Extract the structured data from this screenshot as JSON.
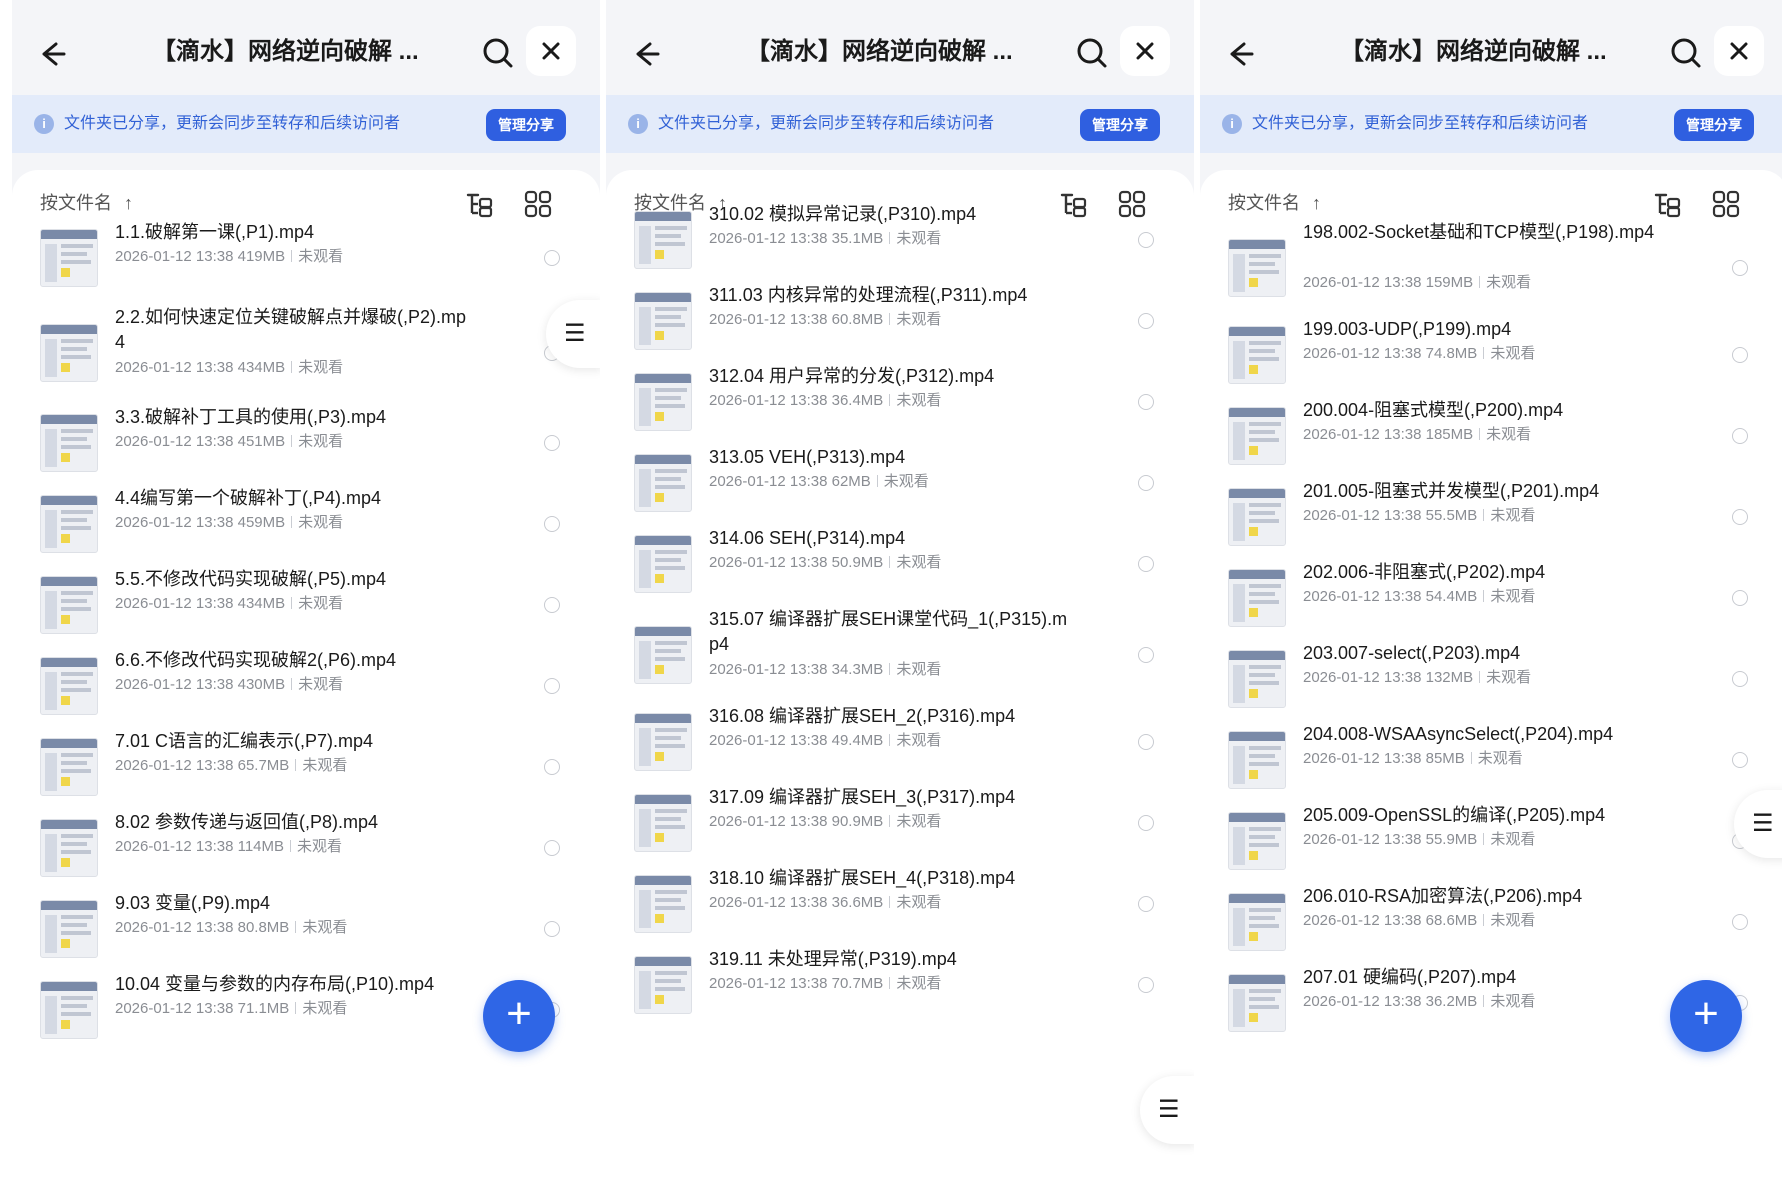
{
  "panels": [
    {
      "title": "【滴水】网络逆向破解 ...",
      "banner_text": "文件夹已分享，更新会同步至转存和后续访问者",
      "manage_label": "管理分享",
      "sort_label": "按文件名",
      "sort_arrow": "↑",
      "files": [
        {
          "name": "1.1.破解第一课(,P1).mp4",
          "date": "2026-01-12 13:38",
          "size": "419MB",
          "status": "未观看"
        },
        {
          "name": "2.2.如何快速定位关键破解点并爆破(,P2).mp4",
          "date": "2026-01-12 13:38",
          "size": "434MB",
          "status": "未观看"
        },
        {
          "name": "3.3.破解补丁工具的使用(,P3).mp4",
          "date": "2026-01-12 13:38",
          "size": "451MB",
          "status": "未观看"
        },
        {
          "name": "4.4编写第一个破解补丁(,P4).mp4",
          "date": "2026-01-12 13:38",
          "size": "459MB",
          "status": "未观看"
        },
        {
          "name": "5.5.不修改代码实现破解(,P5).mp4",
          "date": "2026-01-12 13:38",
          "size": "434MB",
          "status": "未观看"
        },
        {
          "name": "6.6.不修改代码实现破解2(,P6).mp4",
          "date": "2026-01-12 13:38",
          "size": "430MB",
          "status": "未观看"
        },
        {
          "name": "7.01 C语言的汇编表示(,P7).mp4",
          "date": "2026-01-12 13:38",
          "size": "65.7MB",
          "status": "未观看"
        },
        {
          "name": "8.02 参数传递与返回值(,P8).mp4",
          "date": "2026-01-12 13:38",
          "size": "114MB",
          "status": "未观看"
        },
        {
          "name": "9.03 变量(,P9).mp4",
          "date": "2026-01-12 13:38",
          "size": "80.8MB",
          "status": "未观看"
        },
        {
          "name": "10.04 变量与参数的内存布局(,P10).mp4",
          "date": "2026-01-12 13:38",
          "size": "71.1MB",
          "status": "未观看"
        }
      ]
    },
    {
      "title": "【滴水】网络逆向破解 ...",
      "banner_text": "文件夹已分享，更新会同步至转存和后续访问者",
      "manage_label": "管理分享",
      "sort_label": "按文件名",
      "sort_arrow": "↑",
      "files": [
        {
          "name": "310.02 模拟异常记录(,P310).mp4",
          "date": "2026-01-12 13:38",
          "size": "35.1MB",
          "status": "未观看"
        },
        {
          "name": "311.03 内核异常的处理流程(,P311).mp4",
          "date": "2026-01-12 13:38",
          "size": "60.8MB",
          "status": "未观看"
        },
        {
          "name": "312.04 用户异常的分发(,P312).mp4",
          "date": "2026-01-12 13:38",
          "size": "36.4MB",
          "status": "未观看"
        },
        {
          "name": "313.05 VEH(,P313).mp4",
          "date": "2026-01-12 13:38",
          "size": "62MB",
          "status": "未观看"
        },
        {
          "name": "314.06 SEH(,P314).mp4",
          "date": "2026-01-12 13:38",
          "size": "50.9MB",
          "status": "未观看"
        },
        {
          "name": "315.07 编译器扩展SEH课堂代码_1(,P315).mp4",
          "date": "2026-01-12 13:38",
          "size": "34.3MB",
          "status": "未观看"
        },
        {
          "name": "316.08 编译器扩展SEH_2(,P316).mp4",
          "date": "2026-01-12 13:38",
          "size": "49.4MB",
          "status": "未观看"
        },
        {
          "name": "317.09 编译器扩展SEH_3(,P317).mp4",
          "date": "2026-01-12 13:38",
          "size": "90.9MB",
          "status": "未观看"
        },
        {
          "name": "318.10 编译器扩展SEH_4(,P318).mp4",
          "date": "2026-01-12 13:38",
          "size": "36.6MB",
          "status": "未观看"
        },
        {
          "name": "319.11 未处理异常(,P319).mp4",
          "date": "2026-01-12 13:38",
          "size": "70.7MB",
          "status": "未观看"
        }
      ]
    },
    {
      "title": "【滴水】网络逆向破解 ...",
      "banner_text": "文件夹已分享，更新会同步至转存和后续访问者",
      "manage_label": "管理分享",
      "sort_label": "按文件名",
      "sort_arrow": "↑",
      "files": [
        {
          "name": "198.002-Socket基础和TCP模型(,P198).mp4",
          "date": "2026-01-12 13:38",
          "size": "159MB",
          "status": "未观看"
        },
        {
          "name": "199.003-UDP(,P199).mp4",
          "date": "2026-01-12 13:38",
          "size": "74.8MB",
          "status": "未观看"
        },
        {
          "name": "200.004-阻塞式模型(,P200).mp4",
          "date": "2026-01-12 13:38",
          "size": "185MB",
          "status": "未观看"
        },
        {
          "name": "201.005-阻塞式并发模型(,P201).mp4",
          "date": "2026-01-12 13:38",
          "size": "55.5MB",
          "status": "未观看"
        },
        {
          "name": "202.006-非阻塞式(,P202).mp4",
          "date": "2026-01-12 13:38",
          "size": "54.4MB",
          "status": "未观看"
        },
        {
          "name": "203.007-select(,P203).mp4",
          "date": "2026-01-12 13:38",
          "size": "132MB",
          "status": "未观看"
        },
        {
          "name": "204.008-WSAAsyncSelect(,P204).mp4",
          "date": "2026-01-12 13:38",
          "size": "85MB",
          "status": "未观看"
        },
        {
          "name": "205.009-OpenSSL的编译(,P205).mp4",
          "date": "2026-01-12 13:38",
          "size": "55.9MB",
          "status": "未观看"
        },
        {
          "name": "206.010-RSA加密算法(,P206).mp4",
          "date": "2026-01-12 13:38",
          "size": "68.6MB",
          "status": "未观看"
        },
        {
          "name": "207.01 硬编码(,P207).mp4",
          "date": "2026-01-12 13:38",
          "size": "36.2MB",
          "status": "未观看"
        }
      ]
    }
  ],
  "icons": {
    "back": "arrow-left-icon",
    "search": "search-icon",
    "close": "close-icon",
    "info": "info-icon",
    "tree": "folder-tree-icon",
    "grid": "grid-view-icon",
    "add": "plus-icon",
    "menu": "menu-icon"
  },
  "info_glyph": "i",
  "fab_glyph": "+",
  "menu_glyph": "☰",
  "colors": {
    "accent": "#2f5fe0",
    "banner_bg": "#e3ebfa",
    "banner_text": "#3161d6",
    "page_bg": "#f4f5f8",
    "meta_text": "#8a8d93"
  }
}
